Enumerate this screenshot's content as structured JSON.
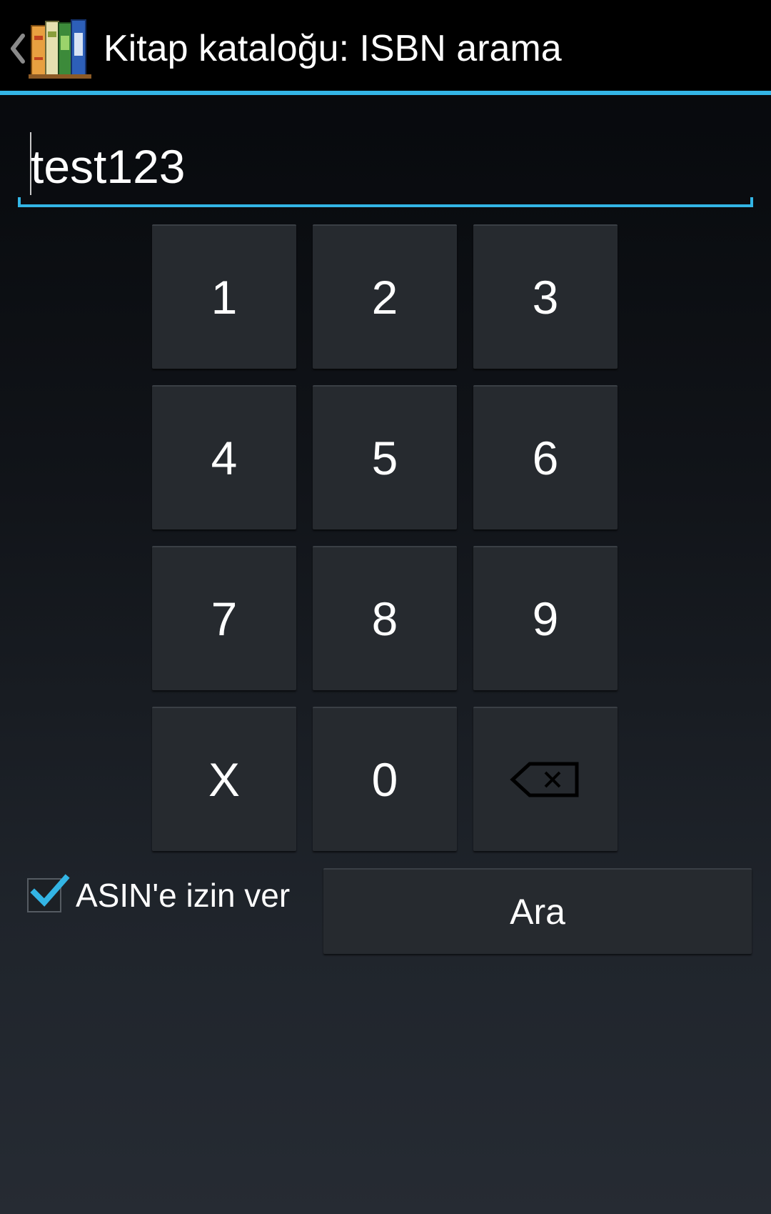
{
  "action_bar": {
    "title": "Kitap kataloğu: ISBN arama",
    "up_icon": "chevron-left-icon",
    "app_icon": "books-icon",
    "accent_color": "#33b5e5"
  },
  "isbn_input": {
    "value": "test123"
  },
  "keypad": {
    "keys": [
      "1",
      "2",
      "3",
      "4",
      "5",
      "6",
      "7",
      "8",
      "9",
      "X",
      "0"
    ],
    "backspace_icon": "backspace-icon"
  },
  "asin_option": {
    "label": "ASIN'e izin ver",
    "checked": true
  },
  "search_button": {
    "label": "Ara"
  }
}
